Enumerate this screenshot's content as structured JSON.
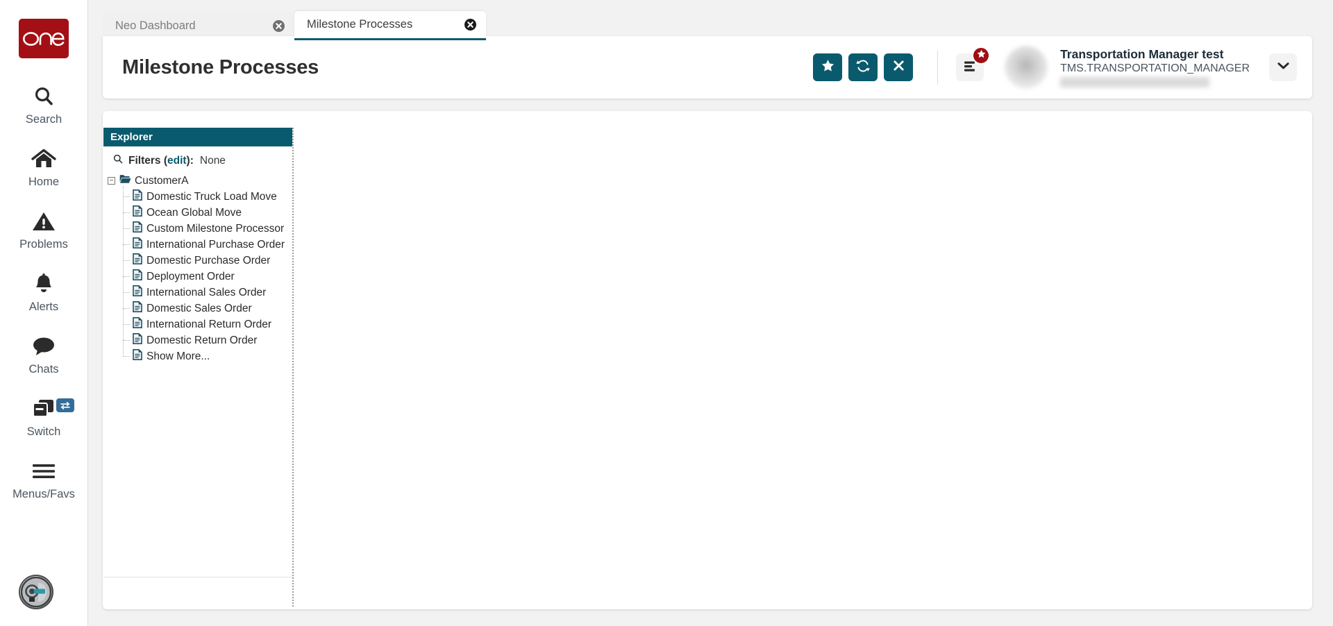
{
  "theme": {
    "accent_teal": "#0a5a6e",
    "brand_red": "#a30f14",
    "badge_red": "#9d1014",
    "switch_badge_blue": "#336d99"
  },
  "left_rail": {
    "logo_text": "one",
    "items": [
      {
        "label": "Search",
        "icon": "search-icon"
      },
      {
        "label": "Home",
        "icon": "home-icon"
      },
      {
        "label": "Problems",
        "icon": "warning-triangle-icon"
      },
      {
        "label": "Alerts",
        "icon": "bell-icon"
      },
      {
        "label": "Chats",
        "icon": "chat-bubble-icon"
      },
      {
        "label": "Switch",
        "icon": "windows-stack-icon",
        "badge_icon": "swap-arrows-icon"
      },
      {
        "label": "Menus/Favs",
        "icon": "hamburger-icon"
      }
    ],
    "assistant_avatar_icon": "ai-assistant-avatar-icon"
  },
  "tabs": [
    {
      "title": "Neo Dashboard",
      "active": false,
      "close_icon": "close-circle-icon"
    },
    {
      "title": "Milestone Processes",
      "active": true,
      "close_icon": "close-circle-icon"
    }
  ],
  "header": {
    "title": "Milestone Processes",
    "actions": [
      {
        "name": "favorite-button",
        "icon": "star-icon",
        "label": "Favorite"
      },
      {
        "name": "refresh-button",
        "icon": "refresh-icon",
        "label": "Refresh"
      },
      {
        "name": "close-button",
        "icon": "x-icon",
        "label": "Close"
      }
    ],
    "menu_favs": {
      "icon": "menu-list-icon",
      "badge_icon": "star-icon"
    },
    "user": {
      "name": "Transportation Manager test",
      "role": "TMS.TRANSPORTATION_MANAGER",
      "caret_icon": "chevron-down-icon",
      "avatar_icon": "avatar"
    }
  },
  "explorer": {
    "header_title": "Explorer",
    "filters": {
      "search_icon": "search-icon",
      "label": "Filters (",
      "edit_label": "edit",
      "label_end": "):",
      "value": "None"
    },
    "tree": {
      "root": {
        "label": "CustomerA",
        "icon": "folder-open-icon",
        "toggle": "−",
        "expanded": true
      },
      "children": [
        {
          "label": "Domestic Truck Load Move",
          "icon": "document-icon"
        },
        {
          "label": "Ocean Global Move",
          "icon": "document-icon"
        },
        {
          "label": "Custom Milestone Processor",
          "icon": "document-icon"
        },
        {
          "label": "International Purchase Order",
          "icon": "document-icon"
        },
        {
          "label": "Domestic Purchase Order",
          "icon": "document-icon"
        },
        {
          "label": "Deployment Order",
          "icon": "document-icon"
        },
        {
          "label": "International Sales Order",
          "icon": "document-icon"
        },
        {
          "label": "Domestic Sales Order",
          "icon": "document-icon"
        },
        {
          "label": "International Return Order",
          "icon": "document-icon"
        },
        {
          "label": "Domestic Return Order",
          "icon": "document-icon"
        },
        {
          "label": "Show More...",
          "icon": "document-icon"
        }
      ]
    }
  }
}
